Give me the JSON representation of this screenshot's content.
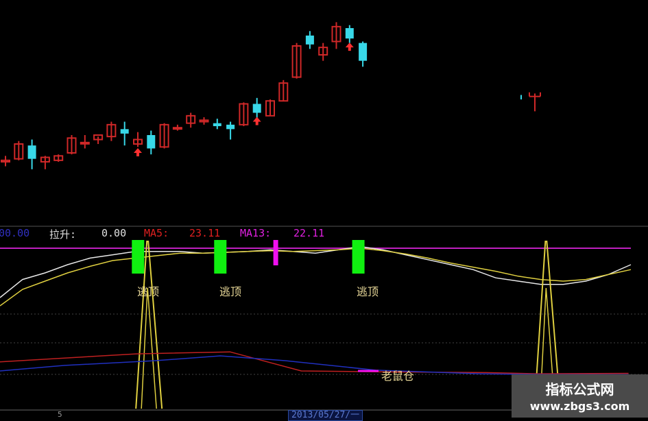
{
  "colors": {
    "background": "#000000",
    "candle_up": "#d02828",
    "candle_down": "#38d8e8",
    "buy_arrow": "#ff3030",
    "ma_white": "#e8e8e8",
    "ma_yellow": "#e0d040",
    "hline": "#c020c0",
    "signal_green": "#10f010",
    "signal_magenta": "#f010f0",
    "spike": "#e0d040",
    "line_red": "#c02020",
    "line_blue": "#2030c0",
    "grid": "#505050"
  },
  "indicator_header": {
    "prefix": "00.00",
    "lashen_label": "拉升:",
    "lashen_value": "0.00",
    "ma5_label": "MA5:",
    "ma5_value": "23.11",
    "ma13_label": "MA13:",
    "ma13_value": "22.11"
  },
  "annotations": {
    "escape_1": "逃顶",
    "escape_2": "逃顶",
    "escape_3": "逃顶",
    "mouse_position": "老鼠仓"
  },
  "watermark": {
    "title": "指标公式网",
    "url": "www.zbgs3.com"
  },
  "cursor_date": "2013/05/27/一",
  "axis_tick_left": "5",
  "chart_data": [
    {
      "type": "candlestick",
      "panel": "price",
      "title": "",
      "candles": [
        {
          "o": 18.8,
          "h": 19.2,
          "l": 18.5,
          "c": 18.9
        },
        {
          "o": 19.0,
          "h": 20.2,
          "l": 18.9,
          "c": 20.0
        },
        {
          "o": 19.9,
          "h": 20.3,
          "l": 18.3,
          "c": 19.0
        },
        {
          "o": 18.8,
          "h": 19.2,
          "l": 18.3,
          "c": 19.1
        },
        {
          "o": 18.9,
          "h": 19.3,
          "l": 18.8,
          "c": 19.2
        },
        {
          "o": 19.4,
          "h": 20.6,
          "l": 19.3,
          "c": 20.4
        },
        {
          "o": 20.1,
          "h": 20.6,
          "l": 19.7,
          "c": 20.1
        },
        {
          "o": 20.3,
          "h": 20.5,
          "l": 20.0,
          "c": 20.6
        },
        {
          "o": 20.5,
          "h": 21.5,
          "l": 20.2,
          "c": 21.3
        },
        {
          "o": 21.0,
          "h": 21.5,
          "l": 19.9,
          "c": 20.7
        },
        {
          "o": 20.0,
          "h": 20.8,
          "l": 19.8,
          "c": 20.3
        },
        {
          "o": 20.6,
          "h": 20.9,
          "l": 19.3,
          "c": 19.7
        },
        {
          "o": 19.8,
          "h": 21.4,
          "l": 19.7,
          "c": 21.3
        },
        {
          "o": 21.1,
          "h": 21.3,
          "l": 20.9,
          "c": 21.1
        },
        {
          "o": 21.4,
          "h": 22.1,
          "l": 21.1,
          "c": 21.9
        },
        {
          "o": 21.5,
          "h": 21.8,
          "l": 21.3,
          "c": 21.6
        },
        {
          "o": 21.4,
          "h": 21.7,
          "l": 21.0,
          "c": 21.2
        },
        {
          "o": 21.3,
          "h": 21.5,
          "l": 20.3,
          "c": 21.0
        },
        {
          "o": 21.3,
          "h": 22.8,
          "l": 21.2,
          "c": 22.7
        },
        {
          "o": 22.7,
          "h": 23.1,
          "l": 21.5,
          "c": 22.1
        },
        {
          "o": 21.9,
          "h": 23.0,
          "l": 21.9,
          "c": 22.9
        },
        {
          "o": 22.9,
          "h": 24.3,
          "l": 22.9,
          "c": 24.1
        },
        {
          "o": 24.5,
          "h": 26.8,
          "l": 24.4,
          "c": 26.6
        },
        {
          "o": 27.3,
          "h": 27.6,
          "l": 26.4,
          "c": 26.7
        },
        {
          "o": 26.0,
          "h": 26.8,
          "l": 25.6,
          "c": 26.5
        },
        {
          "o": 26.9,
          "h": 28.2,
          "l": 26.4,
          "c": 27.9
        },
        {
          "o": 27.8,
          "h": 28.0,
          "l": 26.8,
          "c": 27.1
        },
        {
          "o": 26.8,
          "h": 26.9,
          "l": 25.2,
          "c": 25.6
        }
      ],
      "buy_arrows_at": [
        10,
        19,
        26
      ],
      "partial_candle": {
        "o": 23.2,
        "h": 23.4,
        "l": 22.2,
        "c": 22.8
      }
    },
    {
      "type": "line",
      "panel": "indicator",
      "title": "",
      "series": [
        {
          "name": "MA5",
          "values": [
            0.3,
            0.52,
            0.6,
            0.7,
            0.78,
            0.82,
            0.86,
            0.86,
            0.86,
            0.84,
            0.85,
            0.86,
            0.88,
            0.86,
            0.84,
            0.88,
            0.92,
            0.88,
            0.82,
            0.76,
            0.7,
            0.64,
            0.54,
            0.5,
            0.46,
            0.46,
            0.5,
            0.58,
            0.7
          ]
        },
        {
          "name": "MA13",
          "values": [
            0.2,
            0.4,
            0.5,
            0.6,
            0.68,
            0.75,
            0.78,
            0.81,
            0.84,
            0.84,
            0.85,
            0.86,
            0.87,
            0.86,
            0.87,
            0.88,
            0.9,
            0.87,
            0.83,
            0.78,
            0.72,
            0.67,
            0.62,
            0.56,
            0.52,
            0.5,
            0.52,
            0.58,
            0.64
          ]
        }
      ],
      "reference_line": 0.9,
      "signal_bars": [
        {
          "pos": 0.213,
          "label": "逃顶",
          "color": "green"
        },
        {
          "pos": 0.34,
          "label": "逃顶",
          "color": "green"
        },
        {
          "pos": 0.425,
          "label": "",
          "color": "magenta"
        },
        {
          "pos": 0.553,
          "label": "逃顶",
          "color": "green"
        }
      ],
      "spikes": [
        0.233,
        0.848
      ],
      "bottom_lines": [
        {
          "name": "red",
          "points": [
            [
              0,
              0.35
            ],
            [
              0.21,
              0.55
            ],
            [
              0.355,
              0.6
            ],
            [
              0.465,
              0.12
            ],
            [
              0.58,
              0.1
            ],
            [
              0.75,
              0.08
            ],
            [
              0.83,
              0.05
            ],
            [
              0.97,
              0.06
            ]
          ]
        },
        {
          "name": "blue",
          "points": [
            [
              0,
              0.12
            ],
            [
              0.1,
              0.26
            ],
            [
              0.24,
              0.38
            ],
            [
              0.34,
              0.5
            ],
            [
              0.44,
              0.38
            ],
            [
              0.58,
              0.14
            ],
            [
              0.74,
              0.05
            ],
            [
              0.84,
              0.03
            ],
            [
              0.97,
              0.03
            ]
          ]
        }
      ]
    }
  ]
}
